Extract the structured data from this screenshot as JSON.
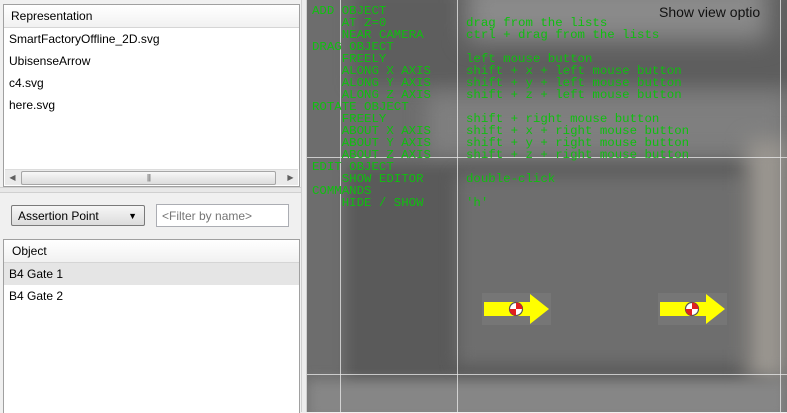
{
  "representation_panel": {
    "header": "Representation",
    "items": [
      "SmartFactoryOffline_2D.svg",
      "UbisenseArrow",
      "c4.svg",
      "here.svg"
    ]
  },
  "controls": {
    "type_select": "Assertion Point",
    "filter_placeholder": "<Filter by name>"
  },
  "object_panel": {
    "header": "Object",
    "items": [
      "B4 Gate 1",
      "B4 Gate 2"
    ]
  },
  "viewport": {
    "show_view_options": "Show view optio",
    "help_lines": [
      {
        "left": "ADD OBJECT",
        "right": ""
      },
      {
        "left": "    AT Z=0",
        "right": "drag from the lists"
      },
      {
        "left": "    NEAR CAMERA",
        "right": "ctrl + drag from the lists"
      },
      {
        "left": "DRAG OBJECT",
        "right": ""
      },
      {
        "left": "    FREELY",
        "right": "left mouse button"
      },
      {
        "left": "    ALONG X AXIS",
        "right": "shift + x + left mouse button"
      },
      {
        "left": "    ALONG Y AXIS",
        "right": "shift + y + left mouse button"
      },
      {
        "left": "    ALONG Z AXIS",
        "right": "shift + z + left mouse button"
      },
      {
        "left": "ROTATE OBJECT",
        "right": ""
      },
      {
        "left": "    FREELY",
        "right": "shift + right mouse button"
      },
      {
        "left": "    ABOUT X AXIS",
        "right": "shift + x + right mouse button"
      },
      {
        "left": "    ABOUT Y AXIS",
        "right": "shift + y + right mouse button"
      },
      {
        "left": "    ABOUT Z AXIS",
        "right": "shift + z + right mouse button"
      },
      {
        "left": "EDIT OBJECT",
        "right": ""
      },
      {
        "left": "    SHOW EDITOR",
        "right": "double-click"
      },
      {
        "left": "COMMANDS",
        "right": ""
      },
      {
        "left": "    HIDE / SHOW",
        "right": "'h'"
      }
    ],
    "colors": {
      "help_text": "#0fbf0f",
      "arrow": "#ffff00",
      "target_red": "#e02020"
    }
  }
}
